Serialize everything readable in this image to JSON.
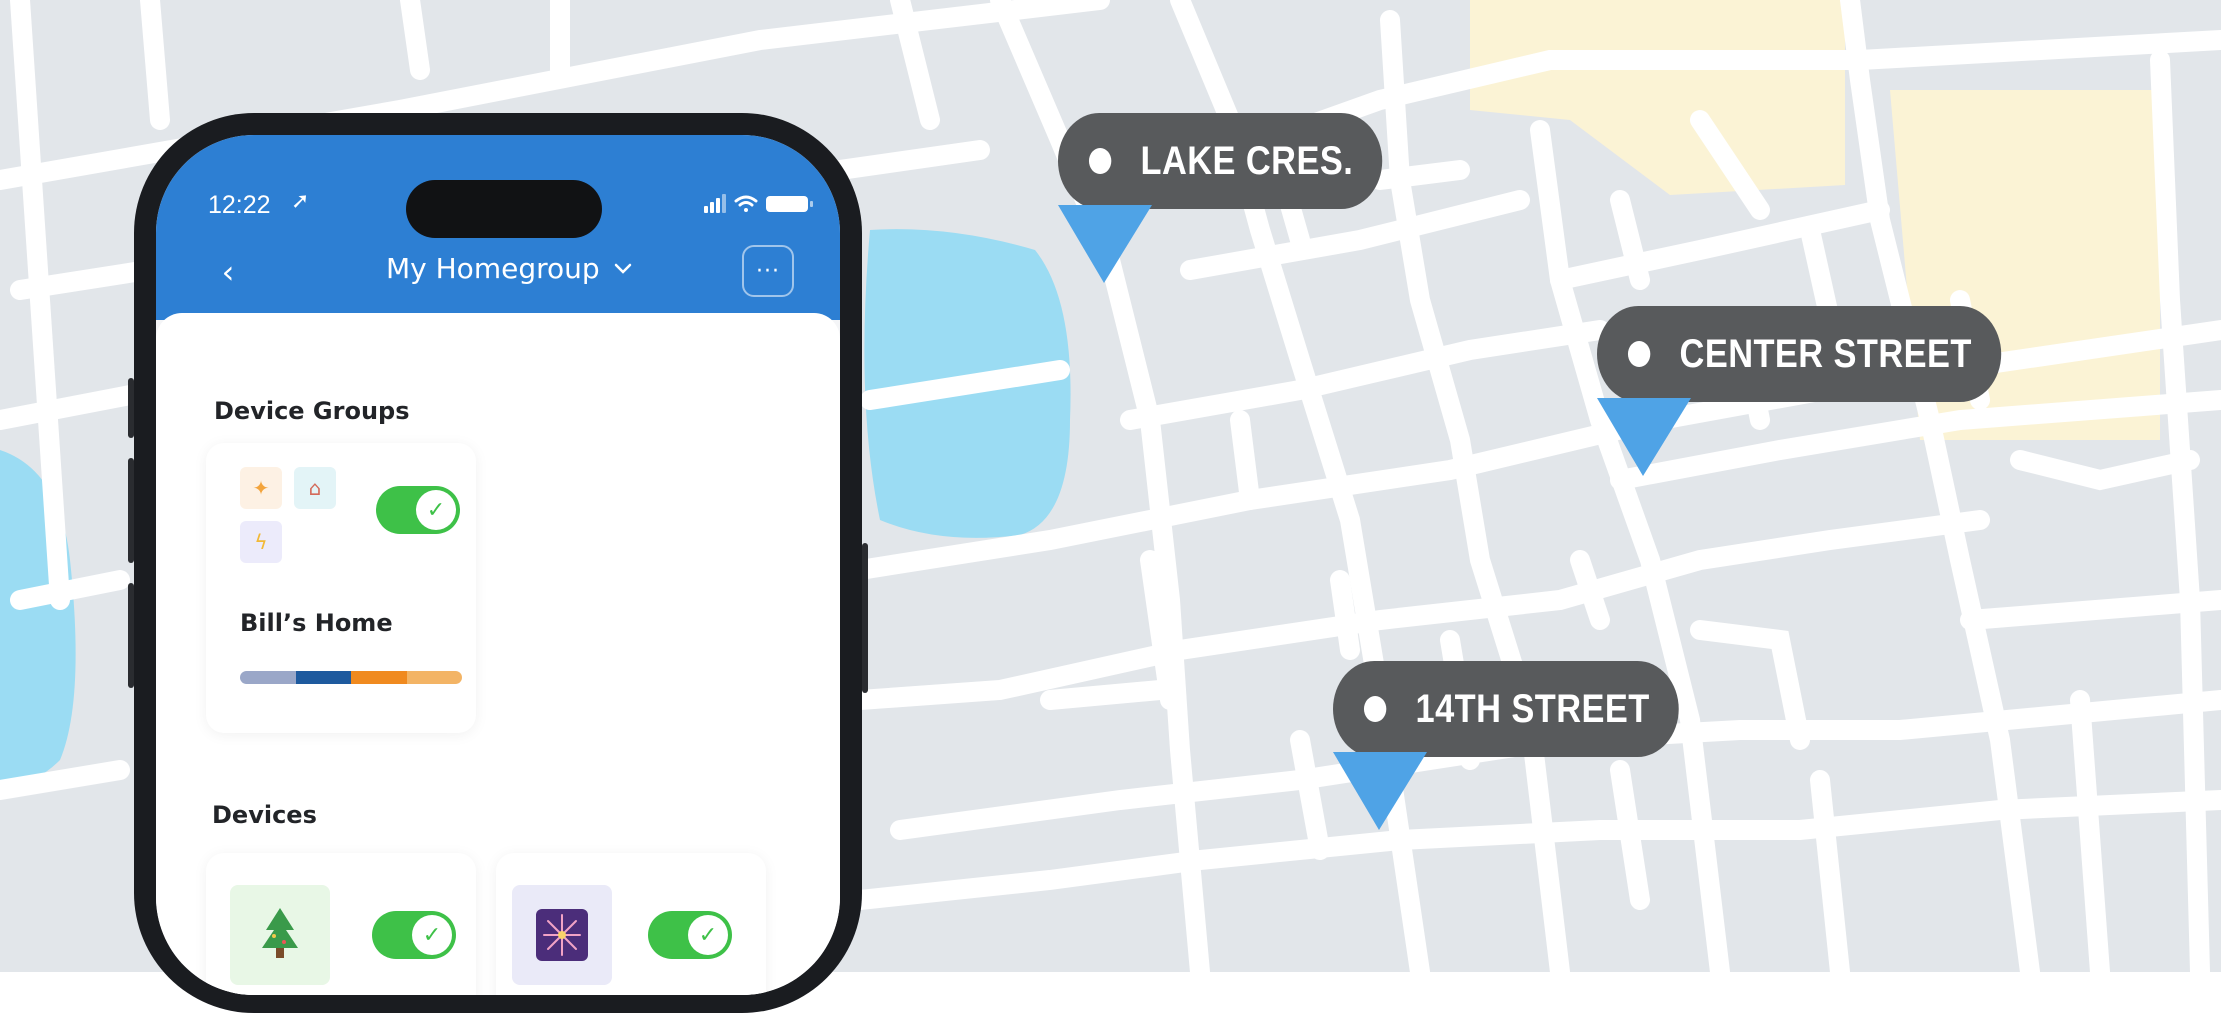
{
  "map": {
    "colors": {
      "land": "#e2e6ea",
      "road": "#ffffff",
      "water": "#9bdcf3",
      "park": "#fbf3d5"
    },
    "pins": [
      {
        "label": "LAKE CRES."
      },
      {
        "label": "CENTER STREET"
      },
      {
        "label": "14TH STREET"
      }
    ],
    "pin_colors": {
      "label_bg": "#585a5c",
      "pointer": "#4fa3e6"
    }
  },
  "phone": {
    "status_bar": {
      "time": "12:22",
      "location_icon": "location-arrow-icon",
      "icons": [
        "signal-icon",
        "wifi-icon",
        "battery-icon"
      ]
    },
    "header": {
      "back_icon": "chevron-left-icon",
      "title": "My Homegroup",
      "dropdown_icon": "chevron-down-icon",
      "menu_label": "···"
    },
    "device_groups": {
      "title": "Device Groups",
      "group": {
        "name": "Bill’s Home",
        "icons": [
          "bulb-icon",
          "house-icon",
          "lightning-icon"
        ],
        "toggle_on": true,
        "bar_colors": [
          "#9aa7c8",
          "#1e5a9e",
          "#f08a1f",
          "#f3b465"
        ]
      }
    },
    "devices": {
      "title": "Devices",
      "items": [
        {
          "icon": "tree-icon",
          "toggle_on": true
        },
        {
          "icon": "sparkle-light-icon",
          "toggle_on": true
        }
      ]
    },
    "accent": "#2d7fd3",
    "toggle_color": "#3ec148"
  }
}
